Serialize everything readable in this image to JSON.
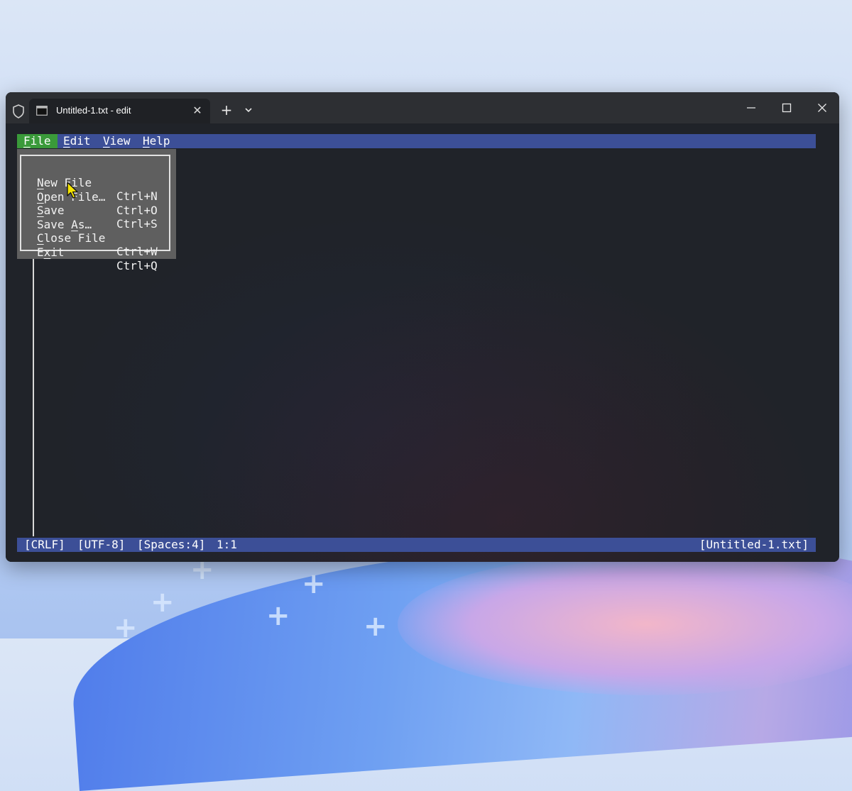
{
  "window": {
    "tab_title": "Untitled-1.txt - edit",
    "tab_close": "✕",
    "new_tab": "+",
    "minimize": "—",
    "maximize": "☐",
    "close": "✕"
  },
  "menubar": {
    "items": [
      {
        "label": "File",
        "underline": "F",
        "rest": "ile",
        "active": true
      },
      {
        "label": "Edit",
        "underline": "E",
        "rest": "dit"
      },
      {
        "label": "View",
        "underline": "V",
        "rest": "iew"
      },
      {
        "label": "Help",
        "underline": "H",
        "rest": "elp"
      }
    ]
  },
  "file_menu": {
    "items": [
      {
        "pre": "",
        "u": "N",
        "post": "ew File",
        "shortcut": "Ctrl+N"
      },
      {
        "pre": "",
        "u": "O",
        "post": "pen File…",
        "shortcut": "Ctrl+O"
      },
      {
        "pre": "",
        "u": "S",
        "post": "ave",
        "shortcut": "Ctrl+S"
      },
      {
        "pre": "Save ",
        "u": "A",
        "post": "s…",
        "shortcut": ""
      },
      {
        "pre": "",
        "u": "C",
        "post": "lose File",
        "shortcut": "Ctrl+W"
      },
      {
        "pre": "E",
        "u": "x",
        "post": "it",
        "shortcut": "Ctrl+Q"
      }
    ]
  },
  "statusbar": {
    "line_ending": "[CRLF]",
    "encoding": "[UTF-8]",
    "indent": "[Spaces:4]",
    "position": "1:1",
    "filename": "[Untitled-1.txt]"
  },
  "colors": {
    "menubar_bg": "#3c4f97",
    "active_menu_bg": "#3a9a3a",
    "menu_bg": "#5f5f5f",
    "terminal_bg": "#202329"
  },
  "icons": {
    "shield": "shield-icon",
    "terminal": "terminal-icon",
    "dropdown": "chevron-down-icon",
    "cursor": "mouse-pointer-icon"
  }
}
